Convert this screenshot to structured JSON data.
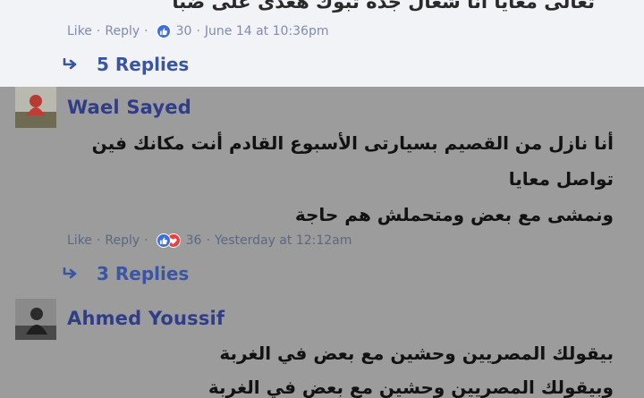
{
  "comment_top": {
    "text": "تعالى معايا أنا شغال جدة تبوك هعدى على ضبا",
    "like_label": "Like",
    "reply_label": "Reply",
    "reaction_count": "30",
    "timestamp": "June 14 at 10:36pm",
    "replies_label": "5 Replies"
  },
  "comment_wael": {
    "author": "Wael Sayed",
    "lines": [
      "أنا نازل من القصيم بسيارتى الأسبوع القادم أنت مكانك فين",
      "تواصل معايا",
      "ونمشى مع بعض ومتحملش هم حاجة"
    ],
    "like_label": "Like",
    "reply_label": "Reply",
    "reaction_count": "36",
    "timestamp": "Yesterday at 12:12am",
    "replies_label": "3 Replies"
  },
  "comment_ahmed": {
    "author": "Ahmed Youssif",
    "lines": [
      "بيقولك المصريين وحشين مع بعض في الغربة",
      "وبيقولك المصريين وحشين مع بعض في الغربة"
    ]
  },
  "colors": {
    "author": "#2f3e86",
    "replies": "#3a56a2",
    "like_reaction": "#3e6fd8",
    "love_reaction": "#e8413f",
    "top_background": "#f2f3f7",
    "dimmed_background": "#9c9c9c"
  },
  "icons": [
    "reply-arrow-icon",
    "like-reaction-icon",
    "love-reaction-icon",
    "avatar"
  ]
}
